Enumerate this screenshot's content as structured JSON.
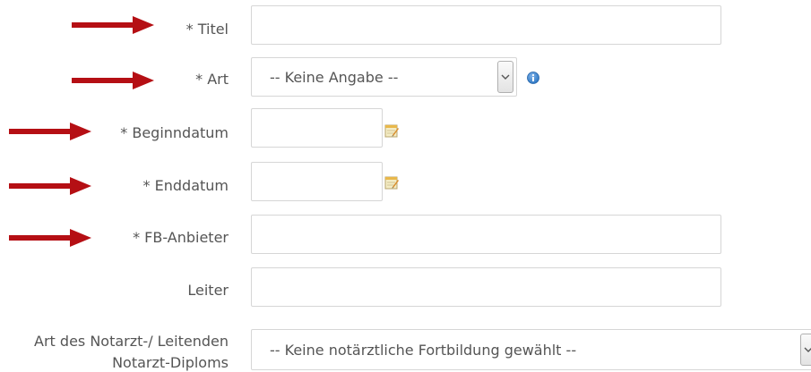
{
  "fields": {
    "titel": {
      "label": "* Titel",
      "value": ""
    },
    "art": {
      "label": "* Art",
      "selected": "-- Keine Angabe --"
    },
    "beginndatum": {
      "label": "* Beginndatum",
      "value": ""
    },
    "enddatum": {
      "label": "* Enddatum",
      "value": ""
    },
    "fb_anbieter": {
      "label": "* FB-Anbieter",
      "value": ""
    },
    "leiter": {
      "label": "Leiter",
      "value": ""
    },
    "notarzt_diplom": {
      "label_line1": "Art des Notarzt-/ Leitenden",
      "label_line2": "Notarzt-Diploms",
      "selected": "-- Keine notärztliche Fortbildung gewählt --"
    }
  },
  "icons": {
    "info": "info-icon",
    "calendar": "calendar-icon",
    "chevron": "chevron-down-icon",
    "annotation_arrow": "red-arrow-icon"
  },
  "colors": {
    "annotation_arrow": "#b50f14",
    "info_icon": "#2f78c4",
    "label_text": "#555555",
    "input_border": "#d6d6d6"
  }
}
